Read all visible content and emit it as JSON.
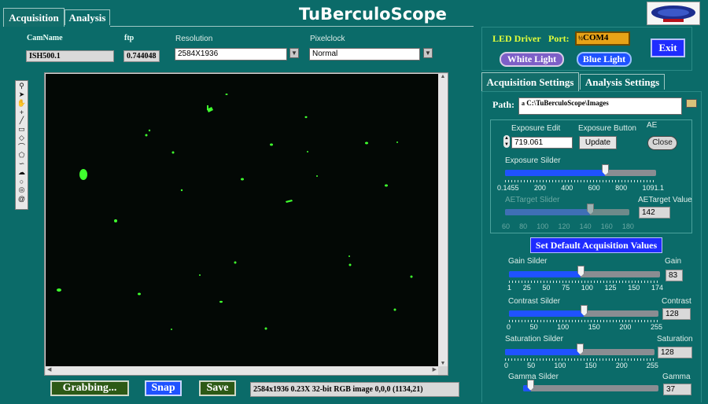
{
  "app_title": "TuBerculoScope",
  "tabs": [
    {
      "label": "Acquisition"
    },
    {
      "label": "Analysis"
    }
  ],
  "cam": {
    "name_label": "CamName",
    "name_value": "ISH500.1",
    "fps_label": "ftp",
    "fps_value": "0.744048",
    "resolution_label": "Resolution",
    "resolution_value": "2584X1936",
    "pixelclock_label": "Pixelclock",
    "pixelclock_value": "Normal"
  },
  "led": {
    "label": "LED Driver",
    "port_label": "Port:",
    "port_value": "COM4",
    "white_label": "White Light",
    "blue_label": "Blue Light",
    "exit_label": "Exit"
  },
  "right_tabs": [
    {
      "label": "Acquisition Settings"
    },
    {
      "label": "Analysis Settings"
    }
  ],
  "path": {
    "label": "Path:",
    "value": "C:\\TuBerculoScope\\Images"
  },
  "exposure": {
    "edit_label": "Exposure Edit",
    "edit_value": "719.061",
    "button_label": "Exposure Button",
    "update_label": "Update",
    "ae_label": "AE",
    "ae_toggle_label": "Close",
    "slider_label": "Exposure Silder",
    "ticks": [
      "0.1455",
      "200",
      "400",
      "600",
      "800",
      "1091.1"
    ],
    "value": 719.061,
    "min": 0.1455,
    "max": 1091.1
  },
  "aetarget": {
    "slider_label": "AETarget Slider",
    "value_label": "AETarget Value",
    "value": "142",
    "ticks": [
      "60",
      "80",
      "100",
      "120",
      "140",
      "160",
      "180"
    ],
    "min": 60,
    "max": 180
  },
  "default_btn": "Set Default Acquisition Values",
  "gain": {
    "slider_label": "Gain Silder",
    "value_label": "Gain",
    "value": "83",
    "ticks": [
      "1",
      "25",
      "50",
      "75",
      "100",
      "125",
      "150",
      "174"
    ],
    "min": 1,
    "max": 174
  },
  "contrast": {
    "slider_label": "Contrast Silder",
    "value_label": "Contrast",
    "value": "128",
    "ticks": [
      "0",
      "50",
      "100",
      "150",
      "200",
      "255"
    ],
    "min": 0,
    "max": 255
  },
  "saturation": {
    "slider_label": "Saturation Silder",
    "value_label": "Saturation",
    "value": "128",
    "ticks": [
      "0",
      "50",
      "100",
      "150",
      "200",
      "255"
    ],
    "min": 0,
    "max": 255
  },
  "gamma": {
    "slider_label": "Gamma Silder",
    "value_label": "Gamma",
    "value": "37"
  },
  "bottom": {
    "grab_label": "Grabbing...",
    "snap_label": "Snap",
    "save_label": "Save",
    "status": "2584x1936 0.23X 32-bit RGB image 0,0,0    (1134,21)"
  },
  "colors": {
    "bg": "#0b6b69",
    "accent_blue": "#1f52ff",
    "fluor_green": "#3fff2e"
  }
}
